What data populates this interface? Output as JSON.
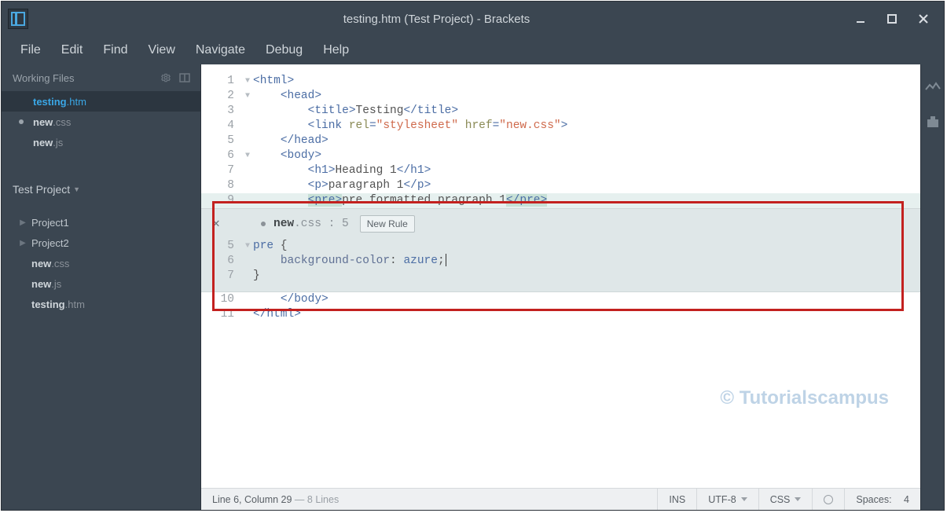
{
  "window": {
    "title": "testing.htm (Test Project) - Brackets"
  },
  "menu": {
    "file": "File",
    "edit": "Edit",
    "find": "Find",
    "view": "View",
    "navigate": "Navigate",
    "debug": "Debug",
    "help": "Help"
  },
  "sidebar": {
    "working_files_label": "Working Files",
    "working_files": [
      {
        "base": "testing",
        "ext": ".htm",
        "active": true,
        "modified": false
      },
      {
        "base": "new",
        "ext": ".css",
        "active": false,
        "modified": true
      },
      {
        "base": "new",
        "ext": ".js",
        "active": false,
        "modified": false
      }
    ],
    "project_label": "Test Project",
    "tree": {
      "folders": [
        "Project1",
        "Project2"
      ],
      "files": [
        {
          "base": "new",
          "ext": ".css"
        },
        {
          "base": "new",
          "ext": ".js"
        },
        {
          "base": "testing",
          "ext": ".htm"
        }
      ]
    }
  },
  "editor": {
    "lines": {
      "l1": "1",
      "l2": "2",
      "l3": "3",
      "l4": "4",
      "l5": "5",
      "l6": "6",
      "l7": "7",
      "l8": "8",
      "l9": "9",
      "l10": "10",
      "l11": "11"
    },
    "tokens": {
      "html_open": "html",
      "head_open": "head",
      "title_open": "title",
      "title_text": "Testing",
      "title_close": "title",
      "link_tag": "link",
      "rel_attr": "rel",
      "rel_val": "\"stylesheet\"",
      "href_attr": "href",
      "href_val": "\"new.css\"",
      "head_close": "head",
      "body_open": "body",
      "h1_open": "h1",
      "h1_text": "Heading 1",
      "h1_close": "h1",
      "p_open": "p",
      "p_text": "paragraph 1",
      "p_close": "p",
      "pre_open": "pre",
      "pre_text": "pre formatted pragraph 1",
      "pre_close": "pre",
      "body_close": "body",
      "html_close": "html"
    }
  },
  "inline": {
    "file_base": "new",
    "file_ext": ".css",
    "file_suffix": " : 5",
    "new_rule_label": "New Rule",
    "lines": {
      "l5": "5",
      "l6": "6",
      "l7": "7"
    },
    "css": {
      "selector": "pre",
      "brace_open": " {",
      "prop": "background-color",
      "colon": ": ",
      "value": "azure",
      "semicolon": ";",
      "brace_close": "}"
    }
  },
  "status": {
    "cursor": "Line 6, Column 29",
    "dash": " — ",
    "lines": "8 Lines",
    "ins": "INS",
    "encoding": "UTF-8",
    "lang": "CSS",
    "spaces_label": "Spaces:",
    "spaces_val": "4"
  },
  "watermark": "© Tutorialscampus"
}
